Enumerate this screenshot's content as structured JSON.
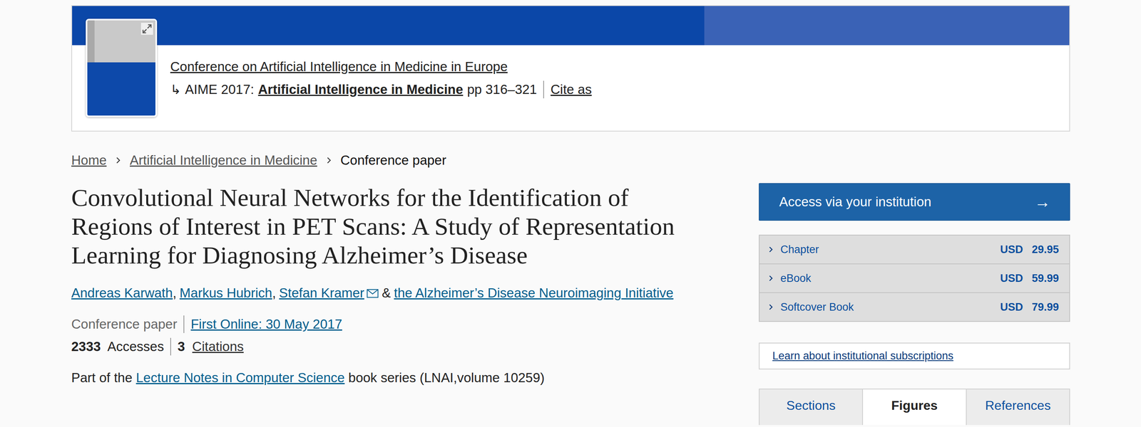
{
  "header": {
    "series": "Conference on Artificial Intelligence in Medicine in Europe",
    "arrow": "↳",
    "conference": "AIME 2017:",
    "book": "Artificial Intelligence in Medicine",
    "pages": "pp 316–321",
    "cite": "Cite as"
  },
  "breadcrumb": [
    {
      "label": "Home",
      "link": true
    },
    {
      "label": "Artificial Intelligence in Medicine",
      "link": true
    },
    {
      "label": "Conference paper",
      "link": false
    }
  ],
  "title": "Convolutional Neural Networks for the Identification of Regions of Interest in PET Scans: A Study of Representation Learning for Diagnosing Alzheimer’s Disease",
  "authors": [
    {
      "name": "Andreas Karwath",
      "email": false,
      "after": ","
    },
    {
      "name": "Markus Hubrich",
      "email": false,
      "after": ","
    },
    {
      "name": "Stefan Kramer",
      "email": true,
      "after": "&"
    },
    {
      "name": "the Alzheimer’s Disease Neuroimaging Initiative",
      "email": false,
      "after": ""
    }
  ],
  "meta": {
    "type": "Conference paper",
    "first_online": "First Online: 30 May 2017",
    "accesses": "2333",
    "accesses_label": "Accesses",
    "citations": "3",
    "citations_label": "Citations"
  },
  "series": {
    "prefix": "Part of the",
    "name": "Lecture Notes in Computer Science",
    "suffix": "book series (LNAI,volume 10259)"
  },
  "access": {
    "label": "Access via your institution",
    "arrow": "→"
  },
  "purchase": [
    {
      "label": "Chapter",
      "currency": "USD",
      "price": "29.95"
    },
    {
      "label": "eBook",
      "currency": "USD",
      "price": "59.99"
    },
    {
      "label": "Softcover Book",
      "currency": "USD",
      "price": "79.99"
    }
  ],
  "subscriptions": "Learn about institutional subscriptions",
  "tabs": [
    {
      "label": "Sections",
      "selected": false
    },
    {
      "label": "Figures",
      "selected": true
    },
    {
      "label": "References",
      "selected": false
    }
  ]
}
